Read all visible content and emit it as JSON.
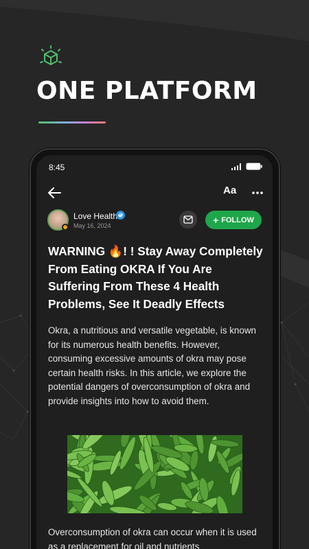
{
  "hero": {
    "title": "ONE PLATFORM",
    "icon": "cube-icon",
    "accent_color": "#4fbf6a"
  },
  "status_bar": {
    "time": "8:45"
  },
  "app_bar": {
    "font_size_label": "Aa"
  },
  "author": {
    "name": "Love Health",
    "date": "May 16, 2024",
    "follow_label": "FOLLOW",
    "follow_color": "#1fa64a"
  },
  "article": {
    "title": "WARNING 🔥! ! Stay Away Completely From Eating OKRA If You Are Suffering From These 4 Health Problems, See It Deadly Effects",
    "paragraph_1": "Okra, a nutritious and versatile vegetable, is known for its numerous health benefits. However, consuming excessive amounts of okra may pose certain health risks. In this article, we explore the potential dangers of overconsumption of okra and provide insights into how to avoid them.",
    "paragraph_2": "Overconsumption of okra can occur when it is used as a replacement for oil and nutrients"
  }
}
